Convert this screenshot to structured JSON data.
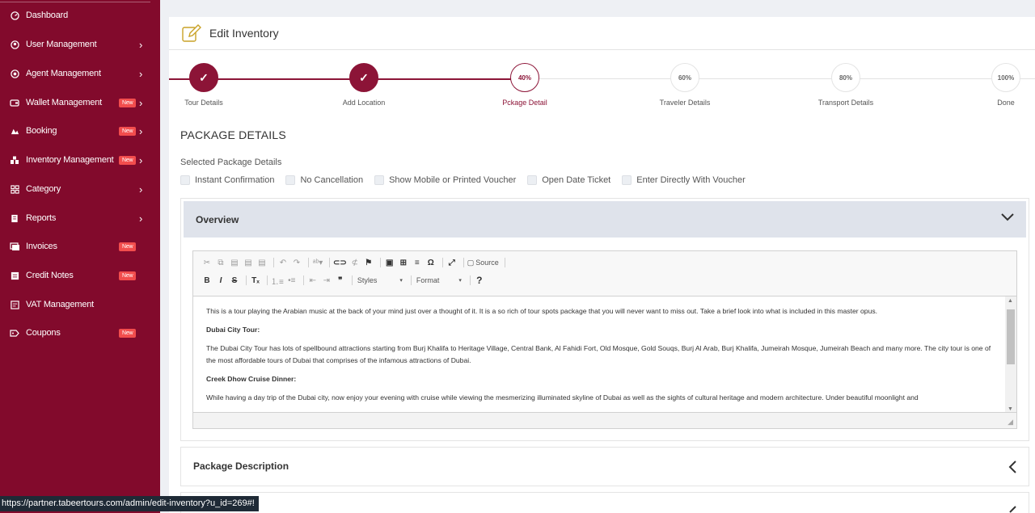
{
  "sidebar": {
    "items": [
      {
        "label": "Dashboard",
        "icon": "dashboard-icon",
        "badge": "",
        "chevron": false
      },
      {
        "label": "User Management",
        "icon": "user-management-icon",
        "badge": "",
        "chevron": true
      },
      {
        "label": "Agent Management",
        "icon": "agent-management-icon",
        "badge": "",
        "chevron": true
      },
      {
        "label": "Wallet Management",
        "icon": "wallet-icon",
        "badge": "New",
        "chevron": true
      },
      {
        "label": "Booking",
        "icon": "booking-icon",
        "badge": "New",
        "chevron": true
      },
      {
        "label": "Inventory Management",
        "icon": "inventory-icon",
        "badge": "New",
        "chevron": true
      },
      {
        "label": "Category",
        "icon": "category-icon",
        "badge": "",
        "chevron": true
      },
      {
        "label": "Reports",
        "icon": "reports-icon",
        "badge": "",
        "chevron": true
      },
      {
        "label": "Invoices",
        "icon": "invoices-icon",
        "badge": "New",
        "chevron": false
      },
      {
        "label": "Credit Notes",
        "icon": "credit-notes-icon",
        "badge": "New",
        "chevron": false
      },
      {
        "label": "VAT Management",
        "icon": "vat-icon",
        "badge": "",
        "chevron": false
      },
      {
        "label": "Coupons",
        "icon": "coupons-icon",
        "badge": "New",
        "chevron": false
      }
    ]
  },
  "header": {
    "title": "Edit Inventory"
  },
  "stepper": {
    "steps": [
      {
        "label": "Tour Details",
        "value": "✓",
        "state": "done"
      },
      {
        "label": "Add Location",
        "value": "✓",
        "state": "done"
      },
      {
        "label": "Pckage Detail",
        "value": "40%",
        "state": "active"
      },
      {
        "label": "Traveler Details",
        "value": "60%",
        "state": "todo"
      },
      {
        "label": "Transport Details",
        "value": "80%",
        "state": "todo"
      },
      {
        "label": "Done",
        "value": "100%",
        "state": "todo"
      }
    ]
  },
  "package": {
    "section_title": "PACKAGE DETAILS",
    "subtitle": "Selected Package Details",
    "options": [
      "Instant Confirmation",
      "No Cancellation",
      "Show Mobile or Printed Voucher",
      "Open Date Ticket",
      "Enter Directly With Voucher"
    ]
  },
  "overview": {
    "title": "Overview",
    "toolbar": {
      "source_label": "Source",
      "styles_label": "Styles",
      "format_label": "Format"
    },
    "content": {
      "p1": "This is a tour playing the Arabian music at the back of your mind just over a thought of it. It is a so rich of tour spots package that you will never want to miss out. Take a brief look into what is included in this master opus.",
      "h1": "Dubai City Tour:",
      "p2": "The Dubai City Tour has lots of spellbound attractions starting from Burj Khalifa to Heritage Village, Central Bank, Al Fahidi Fort, Old Mosque, Gold Souqs, Burj Al Arab, Burj Khalifa, Jumeirah Mosque, Jumeirah Beach and many more. The city tour is one of the most affordable tours of Dubai that comprises of the infamous attractions of Dubai.",
      "h2": "Creek Dhow Cruise Dinner:",
      "p3": "While having a day trip of the Dubai city, now enjoy your evening with cruise while viewing the mesmerizing illuminated skyline of Dubai as well as the sights of cultural heritage and modern architecture. Under beautiful moonlight and"
    }
  },
  "package_description": {
    "title": "Package Description"
  },
  "status_url": "https://partner.tabeertours.com/admin/edit-inventory?u_id=269#!",
  "colors": {
    "brand": "#820a2c",
    "accent": "#8c1437",
    "badge": "#f24d4d"
  }
}
